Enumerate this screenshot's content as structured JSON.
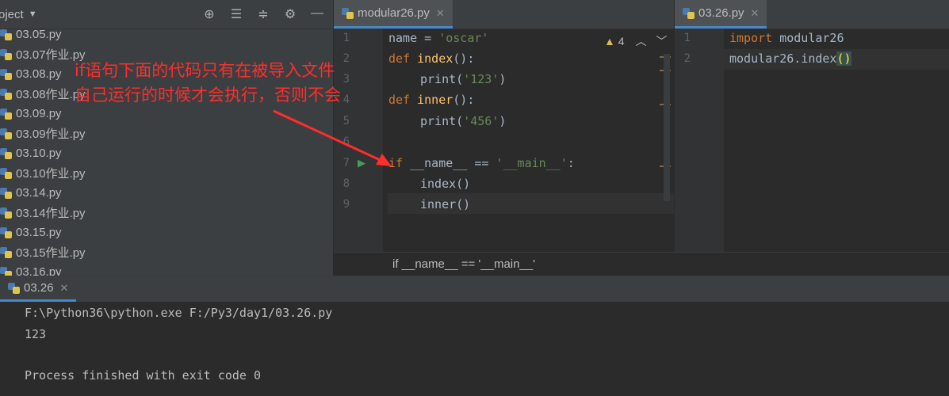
{
  "project": {
    "title": "oject",
    "files": [
      "03.05.py",
      "03.07作业.py",
      "03.08.py",
      "03.08作业.py",
      "03.09.py",
      "03.09作业.py",
      "03.10.py",
      "03.10作业.py",
      "03.14.py",
      "03.14作业.py",
      "03.15.py",
      "03.15作业.py",
      "03.16.py"
    ]
  },
  "editor_left": {
    "tab": "modular26.py",
    "warnings": "4",
    "line_numbers": [
      "1",
      "2",
      "3",
      "4",
      "5",
      "6",
      "7",
      "8",
      "9"
    ]
  },
  "editor_right": {
    "tab": "03.26.py",
    "line_numbers": [
      "1",
      "2"
    ]
  },
  "breadcrumb": "if __name__ == '__main__'",
  "run": {
    "tab": "03.26",
    "lines": [
      "F:\\Python36\\python.exe F:/Py3/day1/03.26.py",
      "123",
      "",
      "Process finished with exit code 0"
    ]
  },
  "annotation": {
    "line1": "if语句下面的代码只有在被导入文件",
    "line2": "自己运行的时候才会执行，否则不会",
    "color": "#ff2d2d"
  },
  "colors": {
    "keyword": "#cc7832",
    "string": "#6a8759",
    "function": "#ffc66d",
    "accent": "#4a88c7"
  }
}
